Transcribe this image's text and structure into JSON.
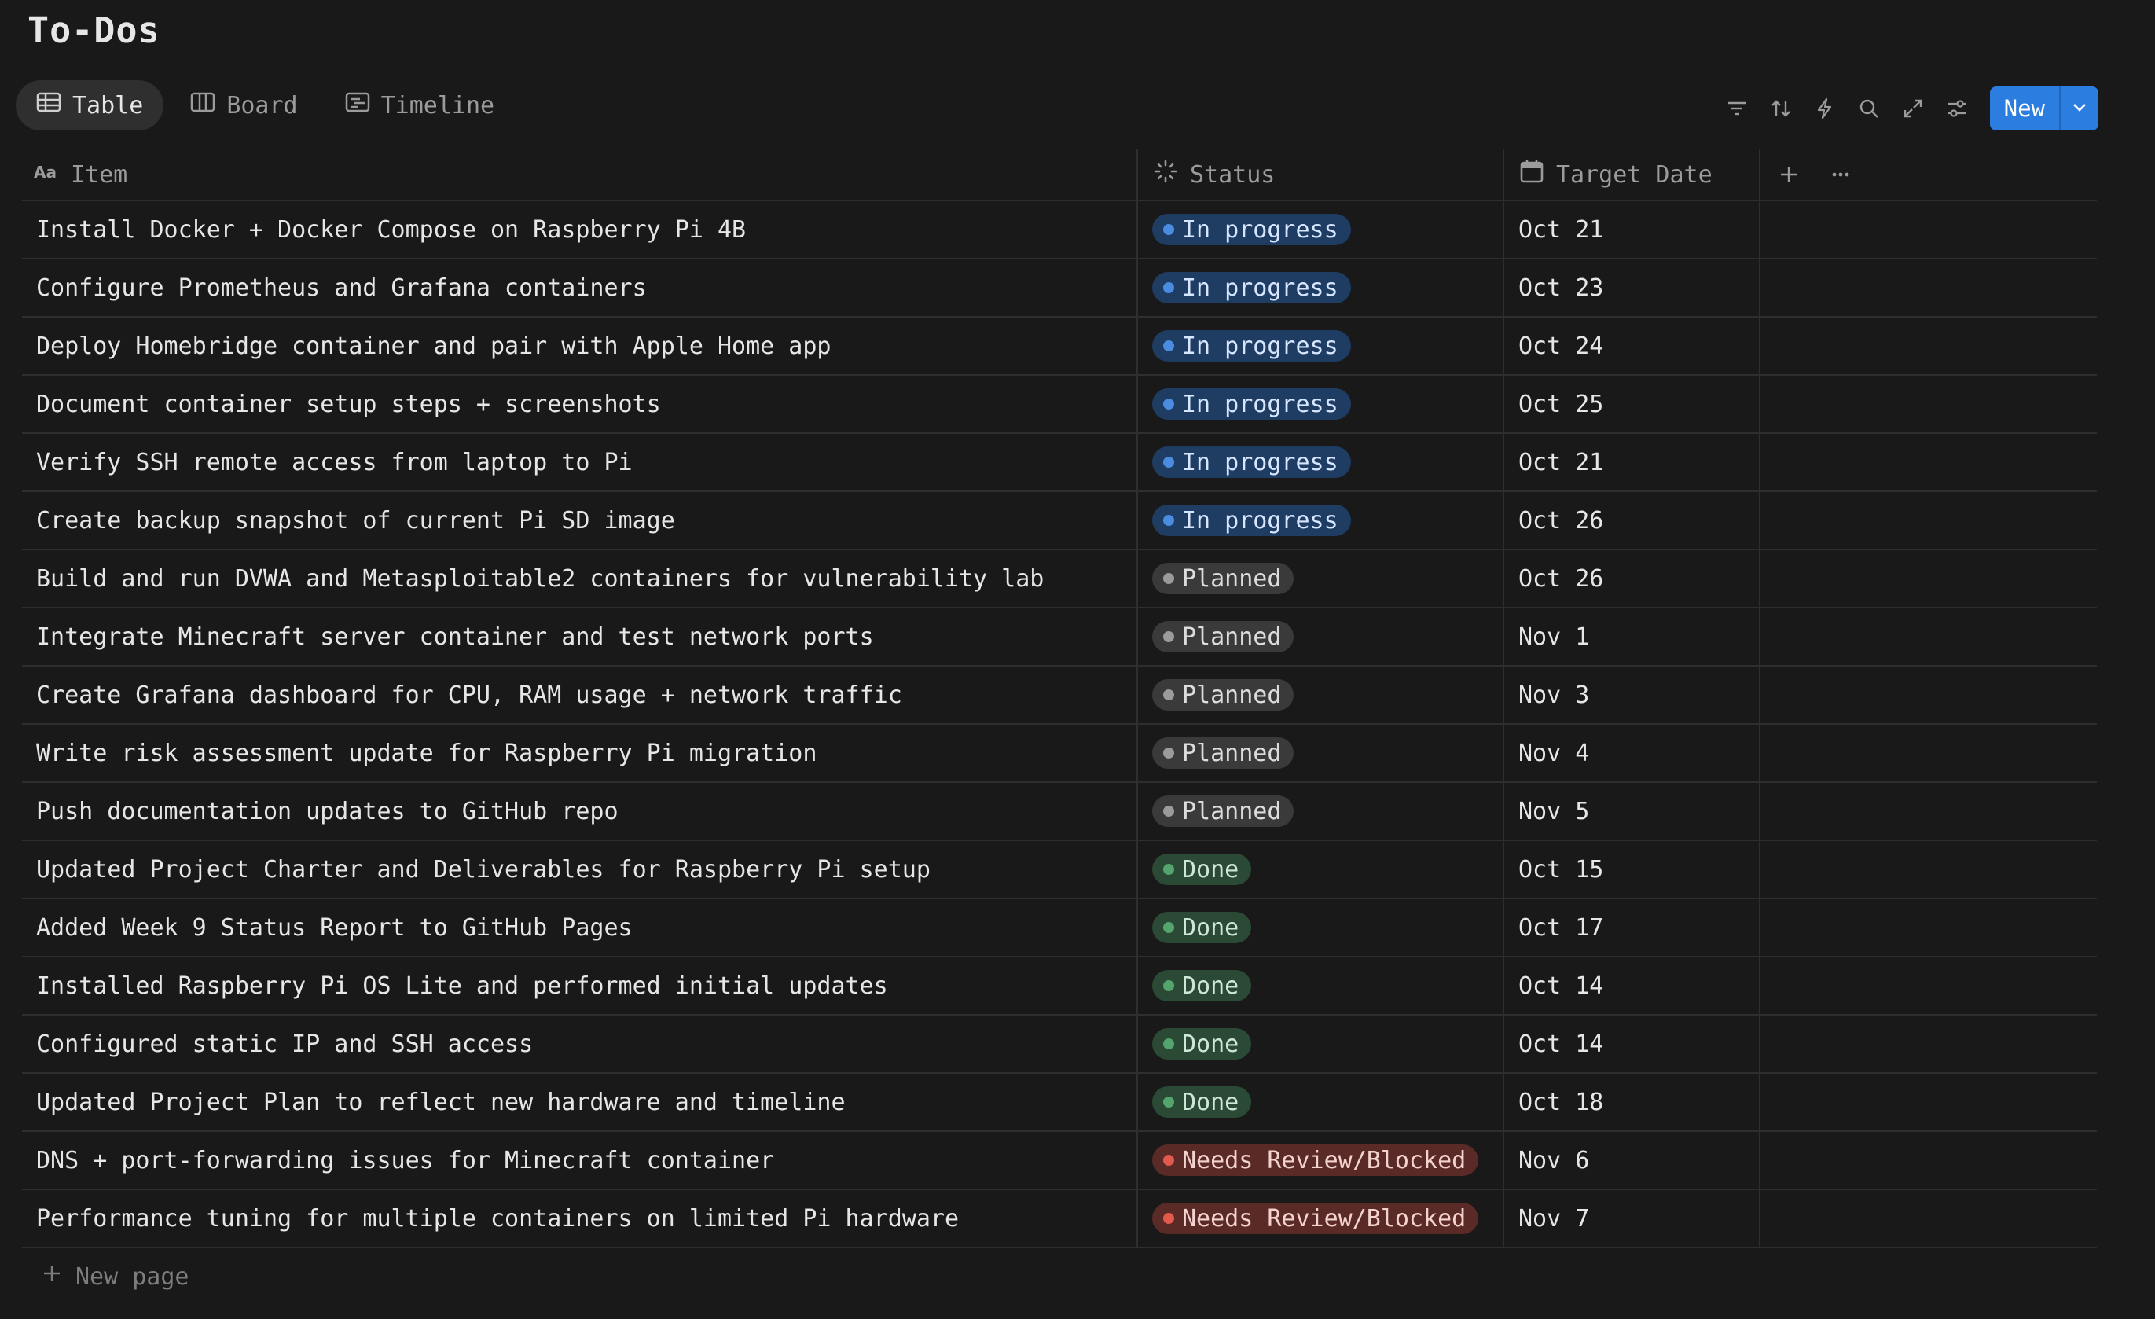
{
  "title": "To-Dos",
  "views": [
    {
      "label": "Table",
      "icon": "table-icon",
      "active": true
    },
    {
      "label": "Board",
      "icon": "board-icon",
      "active": false
    },
    {
      "label": "Timeline",
      "icon": "timeline-icon",
      "active": false
    }
  ],
  "toolbar": {
    "icons": [
      "filter-icon",
      "sort-icon",
      "automation-icon",
      "search-icon",
      "expand-icon",
      "settings-icon"
    ],
    "new_label": "New",
    "accent": "#2c7de0"
  },
  "columns": {
    "item": "Item",
    "status": "Status",
    "target_date": "Target Date"
  },
  "status_colors": {
    "In progress": "#1f3c63",
    "Planned": "#3a3a3a",
    "Done": "#2b4a35",
    "Needs Review/Blocked": "#5a2a26"
  },
  "rows": [
    {
      "item": "Install Docker + Docker Compose on Raspberry Pi 4B",
      "status": "In progress",
      "date": "Oct 21"
    },
    {
      "item": "Configure Prometheus and Grafana containers",
      "status": "In progress",
      "date": "Oct 23"
    },
    {
      "item": "Deploy Homebridge container and pair with Apple Home app",
      "status": "In progress",
      "date": "Oct 24"
    },
    {
      "item": "Document container setup steps + screenshots",
      "status": "In progress",
      "date": "Oct 25"
    },
    {
      "item": "Verify SSH remote access from laptop to Pi",
      "status": "In progress",
      "date": "Oct 21"
    },
    {
      "item": "Create backup snapshot of current Pi SD image",
      "status": "In progress",
      "date": "Oct 26"
    },
    {
      "item": "Build and run DVWA and Metasploitable2 containers for vulnerability lab",
      "status": "Planned",
      "date": "Oct 26"
    },
    {
      "item": "Integrate Minecraft server container and test network ports",
      "status": "Planned",
      "date": "Nov 1"
    },
    {
      "item": "Create Grafana dashboard for CPU, RAM usage + network traffic",
      "status": "Planned",
      "date": "Nov 3"
    },
    {
      "item": "Write risk assessment update for Raspberry Pi migration",
      "status": "Planned",
      "date": "Nov 4"
    },
    {
      "item": "Push documentation updates to GitHub repo",
      "status": "Planned",
      "date": "Nov 5"
    },
    {
      "item": "Updated Project Charter and Deliverables for Raspberry Pi setup",
      "status": "Done",
      "date": "Oct 15"
    },
    {
      "item": "Added Week 9 Status Report to GitHub Pages",
      "status": "Done",
      "date": "Oct 17"
    },
    {
      "item": "Installed Raspberry Pi OS Lite and performed initial updates",
      "status": "Done",
      "date": "Oct 14"
    },
    {
      "item": "Configured static IP and SSH access",
      "status": "Done",
      "date": "Oct 14"
    },
    {
      "item": "Updated Project Plan to reflect new hardware and timeline",
      "status": "Done",
      "date": "Oct 18"
    },
    {
      "item": "DNS + port-forwarding issues for Minecraft container",
      "status": "Needs Review/Blocked",
      "date": "Nov 6"
    },
    {
      "item": "Performance tuning for multiple containers on limited Pi hardware",
      "status": "Needs Review/Blocked",
      "date": "Nov 7"
    }
  ],
  "new_page_label": "New page"
}
